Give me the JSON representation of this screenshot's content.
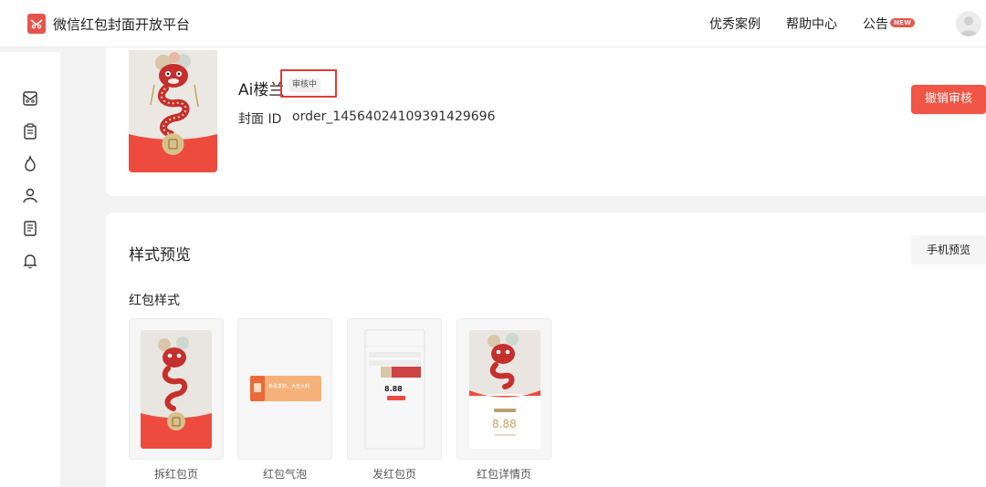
{
  "brand": {
    "title": "微信红包封面开放平台",
    "color": "#e5554b"
  },
  "nav": {
    "items": [
      {
        "label": "优秀案例"
      },
      {
        "label": "帮助中心"
      },
      {
        "label": "公告"
      }
    ],
    "badge": "NEW"
  },
  "sidebar": {
    "icons": [
      "envelope-icon",
      "clipboard-icon",
      "flame-icon",
      "user-icon",
      "document-icon",
      "bell-icon"
    ]
  },
  "cover": {
    "name": "Ai楼兰",
    "status": "审核中",
    "id_label": "封面 ID",
    "id_value": "order_14564024109391429696",
    "cancel_label": "撤销审核"
  },
  "preview": {
    "title": "样式预览",
    "phone_button": "手机预览",
    "subtitle": "红包样式",
    "styles": [
      {
        "label": "拆红包页"
      },
      {
        "label": "红包气泡"
      },
      {
        "label": "发红包页"
      },
      {
        "label": "红包详情页"
      }
    ],
    "bubble_text": "恭喜发财，大吉大利",
    "amount": "8.88",
    "amount_detail": "8.88"
  },
  "colors": {
    "accent": "#f05545",
    "highlight_border": "#e53935"
  }
}
